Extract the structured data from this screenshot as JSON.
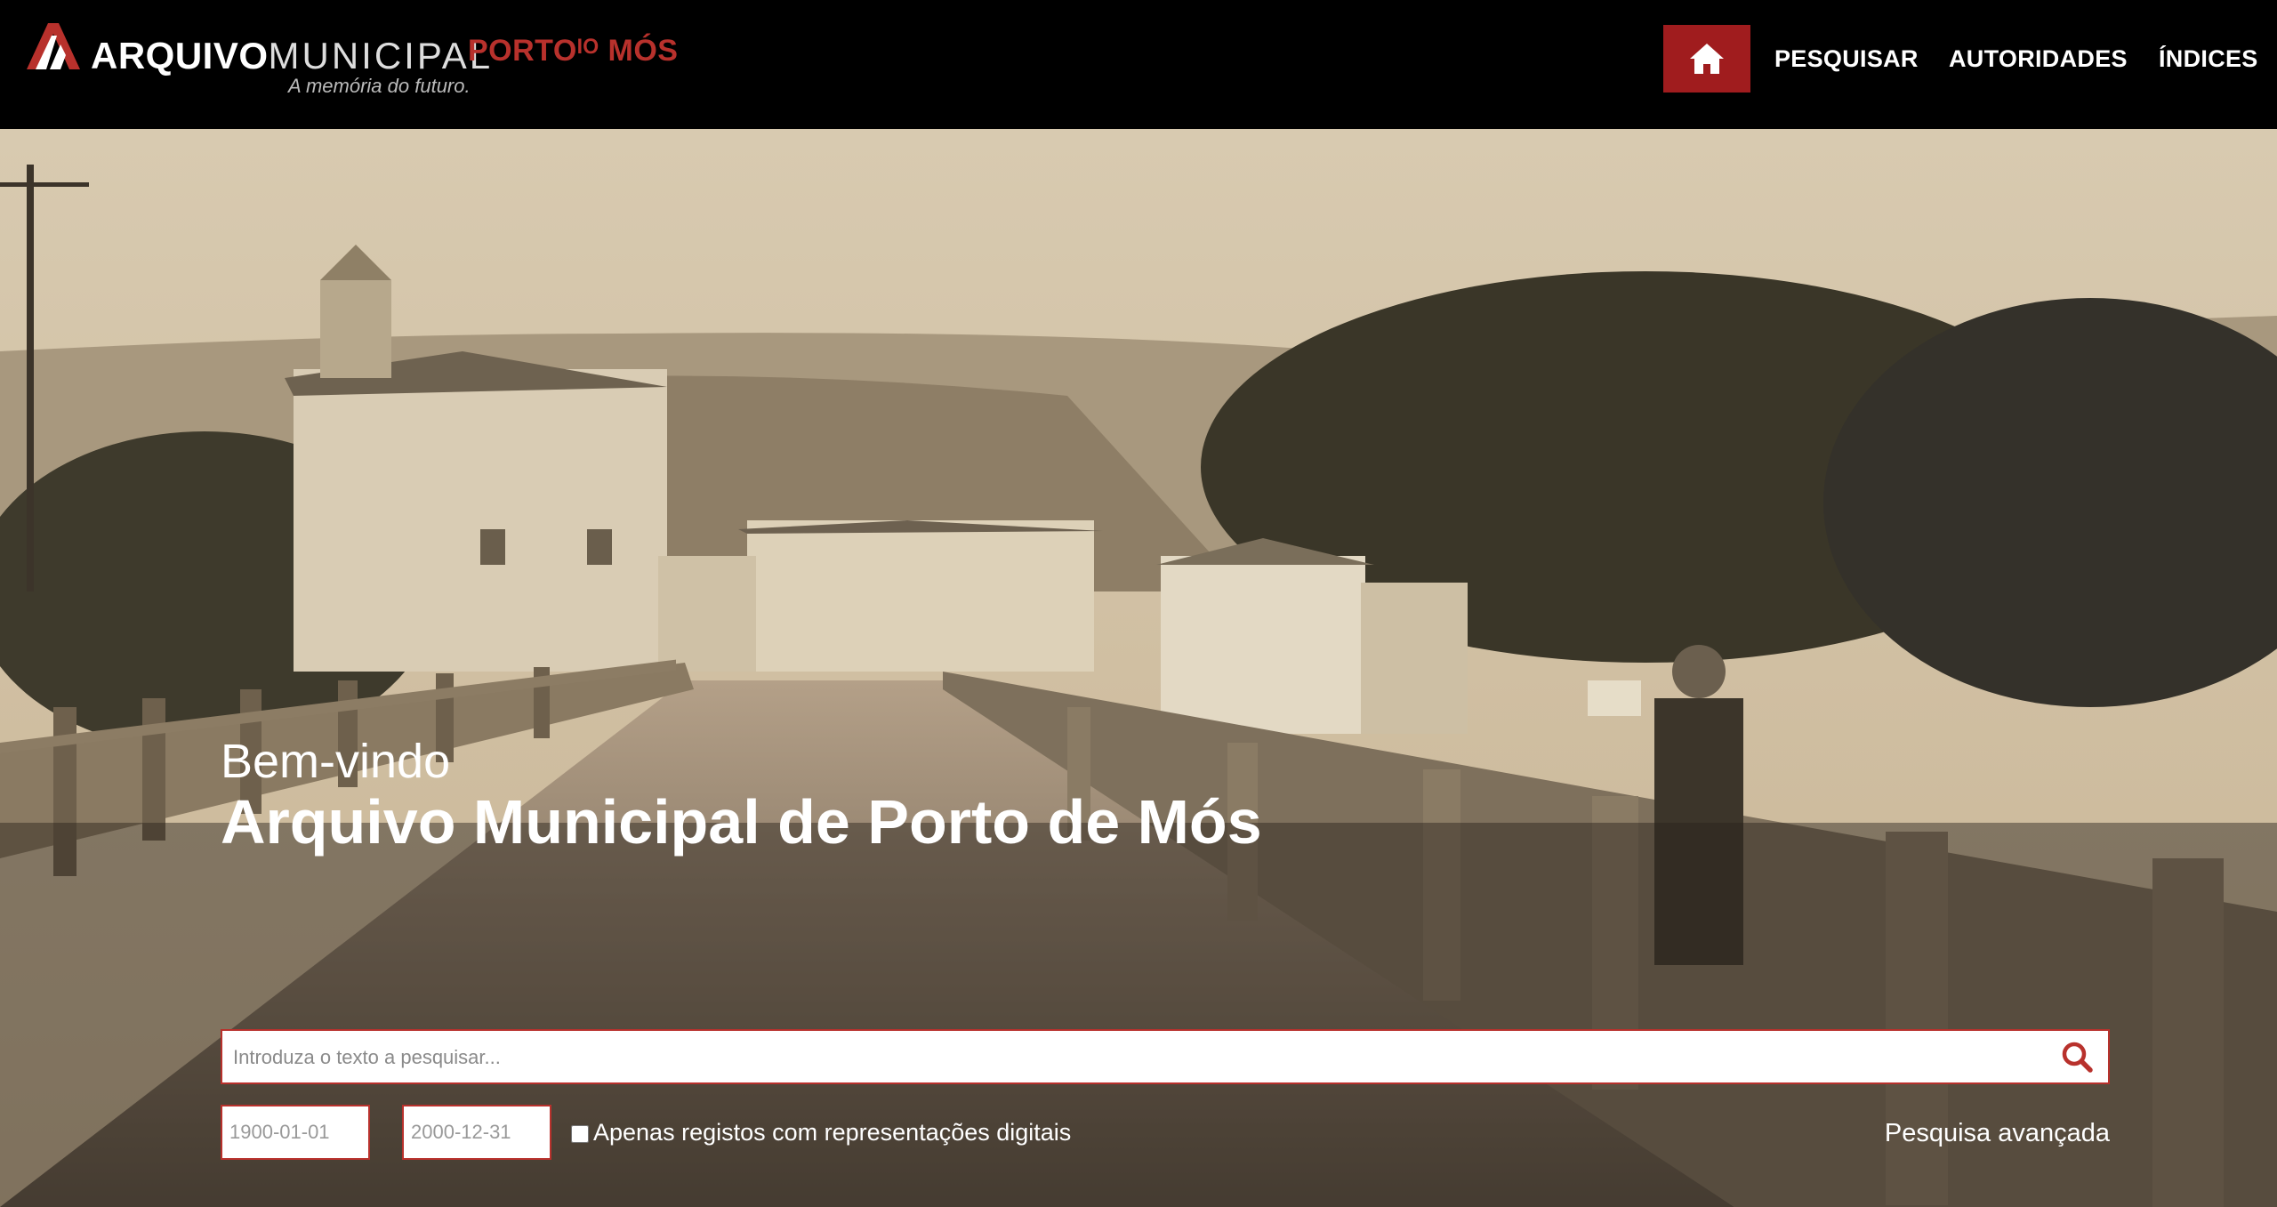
{
  "header": {
    "logo": {
      "word1": "ARQUIVO",
      "word2": "MUNICIPAL",
      "place": "PORTOᴵᴼ MÓS",
      "tagline": "A memória do futuro."
    },
    "nav": {
      "home_icon": "home-icon",
      "items": [
        "PESQUISAR",
        "AUTORIDADES",
        "ÍNDICES"
      ]
    }
  },
  "hero": {
    "welcome": "Bem-vindo",
    "title": "Arquivo Municipal de Porto de Mós",
    "search": {
      "placeholder": "Introduza o texto a pesquisar...",
      "value": "",
      "icon": "search-icon"
    },
    "date_from": {
      "placeholder": "1900-01-01"
    },
    "date_to": {
      "placeholder": "2000-12-31"
    },
    "digital_only": {
      "label": "Apenas registos com representações digitais",
      "checked": false
    },
    "advanced_search": "Pesquisa avançada"
  },
  "colors": {
    "accent": "#a01c1e",
    "header_bg": "#000000",
    "photo_tone": "#cab99a"
  }
}
